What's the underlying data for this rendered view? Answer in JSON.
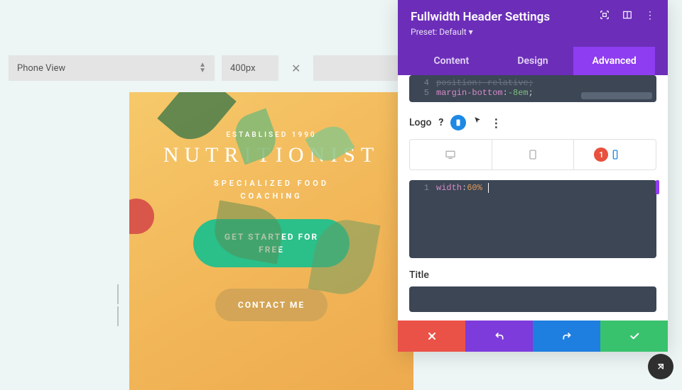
{
  "topbar": {
    "view_mode": "Phone View",
    "width_value": "400px"
  },
  "preview": {
    "established": "ESTABLISED 1990",
    "brand": "NUTRITIONIST",
    "subtitle_line1": "SPECIALIZED FOOD",
    "subtitle_line2": "COACHING",
    "cta_primary_line1": "GET STARTED FOR",
    "cta_primary_line2": "FREE",
    "cta_secondary": "CONTACT ME"
  },
  "panel": {
    "title": "Fullwidth Header Settings",
    "preset_label": "Preset:",
    "preset_value": "Default",
    "tabs": {
      "content": "Content",
      "design": "Design",
      "advanced": "Advanced"
    },
    "code_top": {
      "line4_partial": "position: relative;",
      "line5_prop": "margin-bottom",
      "line5_val": "-8em"
    },
    "logo_label": "Logo",
    "devices_badge": "1",
    "code_logo": {
      "line1_prop": "width",
      "line1_val": "60%"
    },
    "title_label": "Title"
  }
}
